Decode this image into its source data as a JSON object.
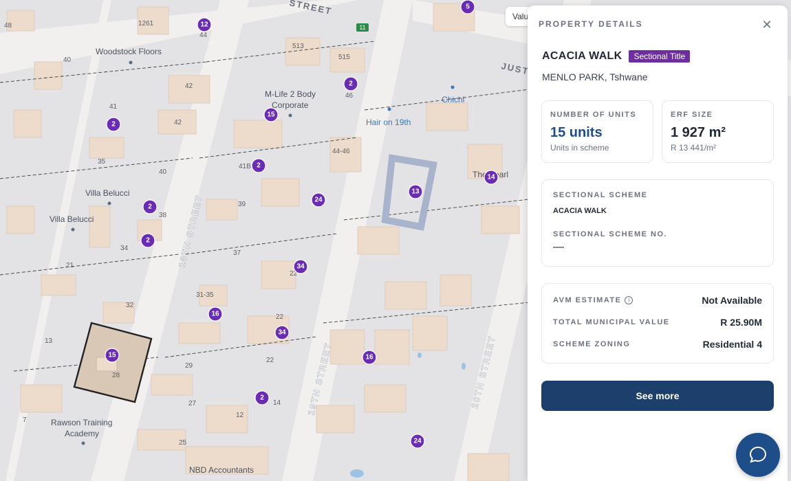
{
  "map": {
    "value_chip": "Valu",
    "route_badge": "11",
    "street_labels": {
      "top": "STREET",
      "just": "JUST",
      "street18": "18TH STREET",
      "street19": "19TH STREET",
      "street20": "20TH STREET"
    },
    "pois": {
      "woodstock": "Woodstock Floors",
      "mlife_1": "M-Life 2 Body",
      "mlife_2": "Corporate",
      "hair": "Hair on 19th",
      "chichi": "Chichi",
      "pearl": "The Pearl",
      "villa1": "Villa Belucci",
      "villa2": "Villa Belucci",
      "rawson1": "Rawson Training",
      "rawson2": "Academy",
      "nbd": "NBD Accountants"
    },
    "markers": [
      "5",
      "12",
      "2",
      "15",
      "2",
      "2",
      "2",
      "24",
      "13",
      "14",
      "34",
      "16",
      "34",
      "15",
      "16",
      "2",
      "24",
      "2"
    ],
    "house_numbers": [
      "48",
      "1261",
      "513",
      "515",
      "40",
      "44",
      "42",
      "41",
      "42",
      "46",
      "35",
      "40",
      "41B",
      "44-46",
      "39",
      "38",
      "34",
      "37",
      "21",
      "31-35",
      "22",
      "32",
      "22",
      "22",
      "13",
      "28",
      "29",
      "27",
      "12",
      "14",
      "7",
      "25"
    ]
  },
  "panel": {
    "header": "PROPERTY DETAILS",
    "title": "ACACIA WALK",
    "badge": "Sectional Title",
    "location": "MENLO PARK, Tshwane",
    "units_label": "NUMBER OF UNITS",
    "units_value": "15 units",
    "units_sub": "Units in scheme",
    "erf_label": "ERF SIZE",
    "erf_value": "1 927 m²",
    "erf_sub": "R 13 441/m²",
    "scheme_label": "SECTIONAL SCHEME",
    "scheme_value": "ACACIA WALK",
    "scheme_no_label": "SECTIONAL SCHEME NO.",
    "scheme_no_value": "—",
    "avm_label": "AVM ESTIMATE",
    "avm_value": "Not Available",
    "municipal_label": "TOTAL MUNICIPAL VALUE",
    "municipal_value": "R 25.90M",
    "zoning_label": "SCHEME ZONING",
    "zoning_value": "Residential 4",
    "button": "See more"
  },
  "colors": {
    "accent": "#1d3f6b",
    "badge": "#6d2f9e",
    "marker": "#6a2bb5",
    "building": "#eddccb"
  }
}
